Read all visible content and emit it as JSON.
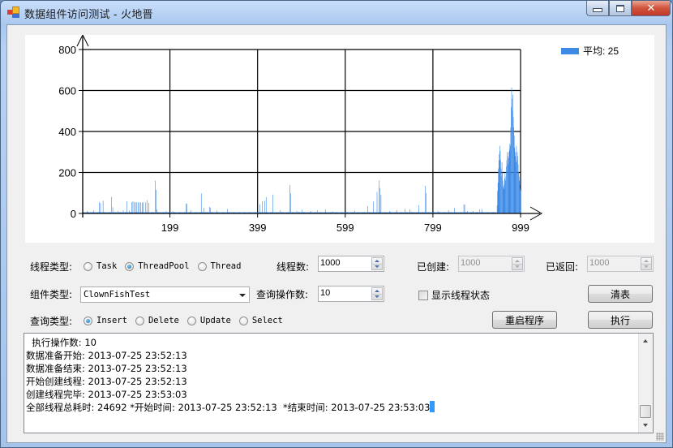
{
  "window": {
    "title": "数据组件访问测试 - 火地晋",
    "buttons": {
      "minimize": "minimize",
      "maximize": "maximize",
      "close": "✕"
    }
  },
  "chart_data": {
    "type": "bar",
    "title": "",
    "xlabel": "",
    "ylabel": "",
    "x_range": [
      0,
      999
    ],
    "ylim": [
      0,
      800
    ],
    "y_ticks": [
      "0",
      "200",
      "400",
      "600",
      "800"
    ],
    "x_ticks": [
      "199",
      "399",
      "599",
      "799",
      "999"
    ],
    "grid": true,
    "legend": {
      "position": "top-right",
      "entries": [
        {
          "label": "平均: 25",
          "color": "#3d8ae6"
        }
      ]
    },
    "series_color": "#3d8ae6",
    "baseline_value": 6,
    "spikes": [
      [
        10,
        12
      ],
      [
        25,
        15
      ],
      [
        37,
        55
      ],
      [
        40,
        50
      ],
      [
        46,
        62
      ],
      [
        65,
        80
      ],
      [
        68,
        30
      ],
      [
        80,
        12
      ],
      [
        92,
        15
      ],
      [
        100,
        60
      ],
      [
        106,
        14
      ],
      [
        111,
        55
      ],
      [
        114,
        60
      ],
      [
        117,
        56
      ],
      [
        120,
        55
      ],
      [
        123,
        55
      ],
      [
        126,
        54
      ],
      [
        129,
        54
      ],
      [
        132,
        54
      ],
      [
        135,
        53
      ],
      [
        137,
        54
      ],
      [
        143,
        54
      ],
      [
        146,
        65
      ],
      [
        150,
        52
      ],
      [
        165,
        160
      ],
      [
        167,
        115
      ],
      [
        169,
        20
      ],
      [
        190,
        12
      ],
      [
        205,
        10
      ],
      [
        235,
        48
      ],
      [
        237,
        48
      ],
      [
        246,
        15
      ],
      [
        270,
        98
      ],
      [
        276,
        28
      ],
      [
        289,
        32
      ],
      [
        291,
        28
      ],
      [
        305,
        14
      ],
      [
        330,
        22
      ],
      [
        404,
        45
      ],
      [
        409,
        60
      ],
      [
        415,
        62
      ],
      [
        418,
        80
      ],
      [
        433,
        92
      ],
      [
        450,
        15
      ],
      [
        472,
        139
      ],
      [
        474,
        98
      ],
      [
        488,
        12
      ],
      [
        500,
        18
      ],
      [
        520,
        12
      ],
      [
        535,
        15
      ],
      [
        553,
        20
      ],
      [
        570,
        10
      ],
      [
        620,
        12
      ],
      [
        650,
        35
      ],
      [
        663,
        58
      ],
      [
        671,
        105
      ],
      [
        676,
        160
      ],
      [
        678,
        124
      ],
      [
        680,
        90
      ],
      [
        700,
        12
      ],
      [
        716,
        15
      ],
      [
        735,
        22
      ],
      [
        746,
        20
      ],
      [
        766,
        40
      ],
      [
        781,
        135
      ],
      [
        783,
        100
      ],
      [
        810,
        12
      ],
      [
        834,
        15
      ],
      [
        848,
        27
      ],
      [
        869,
        45
      ],
      [
        871,
        42
      ],
      [
        877,
        12
      ],
      [
        890,
        12
      ],
      [
        905,
        20
      ],
      [
        910,
        22
      ]
    ],
    "cluster": {
      "start": 945,
      "end": 999,
      "values": [
        40,
        110,
        150,
        220,
        260,
        290,
        330,
        305,
        260,
        220,
        180,
        250,
        200,
        160,
        130,
        120,
        140,
        170,
        200,
        160,
        180,
        230,
        260,
        300,
        280,
        240,
        270,
        300,
        310,
        340,
        330,
        420,
        520,
        615,
        560,
        500,
        580,
        470,
        420,
        380,
        320,
        280,
        300,
        250,
        330,
        260,
        300,
        280,
        240,
        200,
        180,
        160,
        140,
        120,
        110
      ]
    }
  },
  "controls": {
    "thread_type": {
      "label": "线程类型:",
      "options": [
        {
          "label": "Task",
          "selected": false
        },
        {
          "label": "ThreadPool",
          "selected": true
        },
        {
          "label": "Thread",
          "selected": false
        }
      ]
    },
    "thread_count": {
      "label": "线程数:",
      "value": "1000"
    },
    "created": {
      "label": "已创建:",
      "value": "1000"
    },
    "returned": {
      "label": "已返回:",
      "value": "1000"
    },
    "component_type": {
      "label": "组件类型:",
      "value": "ClownFishTest"
    },
    "query_ops": {
      "label": "查询操作数:",
      "value": "10"
    },
    "show_thread_state": {
      "label": "显示线程状态",
      "checked": false
    },
    "query_type": {
      "label": "查询类型:",
      "options": [
        {
          "label": "Insert",
          "selected": true
        },
        {
          "label": "Delete",
          "selected": false
        },
        {
          "label": "Update",
          "selected": false
        },
        {
          "label": "Select",
          "selected": false
        }
      ]
    },
    "buttons": {
      "clear": "清表",
      "restart": "重启程序",
      "execute": "执行"
    }
  },
  "log": {
    "lines": [
      "  执行操作数: 10",
      "数据准备开始: 2013-07-25 23:52:13",
      "数据准备结束: 2013-07-25 23:52:13",
      "开始创建线程: 2013-07-25 23:52:13",
      "创建线程完毕: 2013-07-25 23:53:03",
      "全部线程总耗时: 24692 *开始时间: 2013-07-25 23:52:13  *结束时间: 2013-07-25 23:53:03"
    ]
  }
}
